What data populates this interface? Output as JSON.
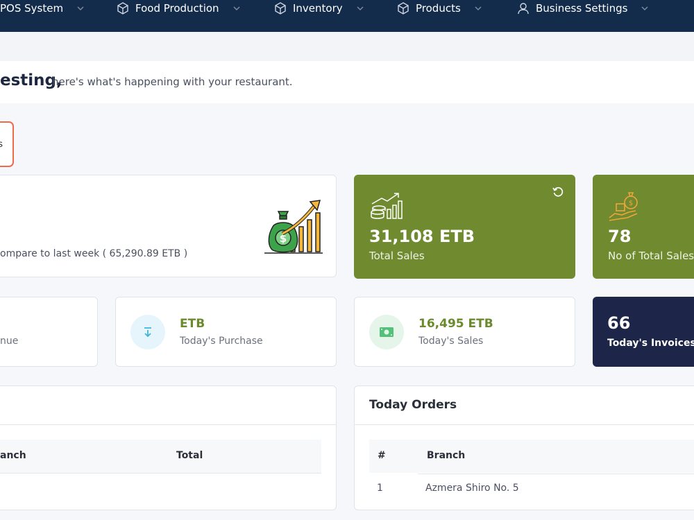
{
  "nav": {
    "items": [
      {
        "label": "POS System",
        "icon": "pos-icon"
      },
      {
        "label": "Food Production",
        "icon": "box-icon"
      },
      {
        "label": "Inventory",
        "icon": "box-icon"
      },
      {
        "label": "Products",
        "icon": "box-icon"
      },
      {
        "label": "Business Settings",
        "icon": "user-icon"
      }
    ]
  },
  "welcome": {
    "name": "esting,",
    "message": "here's what's happening with your restaurant."
  },
  "filter": {
    "label": "s"
  },
  "summary": {
    "compare_text": "ompare to last week ( 65,290.89 ETB )"
  },
  "total_sales": {
    "value": "31,108 ETB",
    "label": "Total Sales"
  },
  "sales_count": {
    "value": "78",
    "label": "No of Total Sales"
  },
  "revenue": {
    "label": "nue"
  },
  "purchase": {
    "value": "ETB",
    "label": "Today's Purchase"
  },
  "today_sales": {
    "value": "16,495 ETB",
    "label": "Today's Sales"
  },
  "invoices": {
    "value": "66",
    "label": "Today's Invoices"
  },
  "left_table": {
    "columns": [
      "anch",
      "Total"
    ]
  },
  "today_orders": {
    "title": "Today Orders",
    "columns": [
      "#",
      "Branch"
    ],
    "rows": [
      {
        "index": "1",
        "branch": "Azmera Shiro No. 5"
      }
    ]
  },
  "colors": {
    "nav_bg": "#142c4c",
    "accent_green": "#6f8a2f",
    "navy_card": "#1d2548",
    "filter_border": "#ee6a4a"
  }
}
